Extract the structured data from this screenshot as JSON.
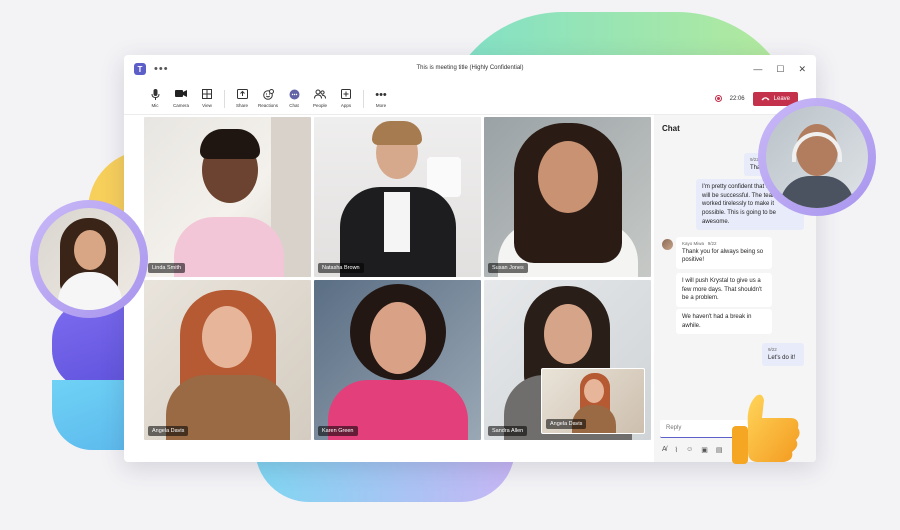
{
  "window": {
    "title": "This is meeting title (Highly Confidential)",
    "more": "•••",
    "minimize": "—",
    "maximize": "☐",
    "close": "✕"
  },
  "toolbar": {
    "items": [
      {
        "label": "Mic",
        "icon": "mic-icon",
        "glyph": "🎙"
      },
      {
        "label": "Camera",
        "icon": "camera-icon",
        "glyph": "■"
      },
      {
        "label": "View",
        "icon": "grid-icon",
        "glyph": "⊞"
      },
      {
        "label": "Share",
        "icon": "share-icon",
        "glyph": "⇧"
      },
      {
        "label": "Reactions",
        "icon": "reactions-icon",
        "glyph": "☺"
      },
      {
        "label": "Chat",
        "icon": "chat-icon",
        "glyph": "💬"
      },
      {
        "label": "People",
        "icon": "people-icon",
        "glyph": "👥"
      },
      {
        "label": "Apps",
        "icon": "apps-icon",
        "glyph": "⊕"
      },
      {
        "label": "More",
        "icon": "more-icon",
        "glyph": "•••"
      }
    ],
    "timer": "22:06",
    "leave_label": "Leave"
  },
  "participants": [
    {
      "name": "Linda Smith"
    },
    {
      "name": "Natasha Brown"
    },
    {
      "name": "Susan Jones"
    },
    {
      "name": "Angela Davis"
    },
    {
      "name": "Karen Green"
    },
    {
      "name": "Sandra Allen"
    }
  ],
  "pip": {
    "name": "Angela Davis"
  },
  "chat": {
    "title": "Chat",
    "more": "•••",
    "messages": [
      {
        "time": "9/22",
        "text": "That would be"
      },
      {
        "text": "I'm pretty confident that this launch will be successful. The team has worked tirelessly to make it possible. This is going to be awesome."
      },
      {
        "author": "Kayo Miwa",
        "time": "9/22",
        "text": "Thank you for always being so positive!"
      },
      {
        "text": "I will push Krystal to give us a few more days. That shouldn't be a problem."
      },
      {
        "text": "We haven't had a break in awhile."
      },
      {
        "time": "9/22",
        "text": "Let's do it!"
      }
    ],
    "reply_placeholder": "Reply",
    "compose_icons": [
      "format-icon",
      "attach-icon",
      "emoji-icon",
      "gif-icon",
      "sticker-icon"
    ]
  },
  "colors": {
    "brand": "#5b5fc7",
    "leave": "#c4314b",
    "chat_self_bubble": "#e8ebfa"
  }
}
